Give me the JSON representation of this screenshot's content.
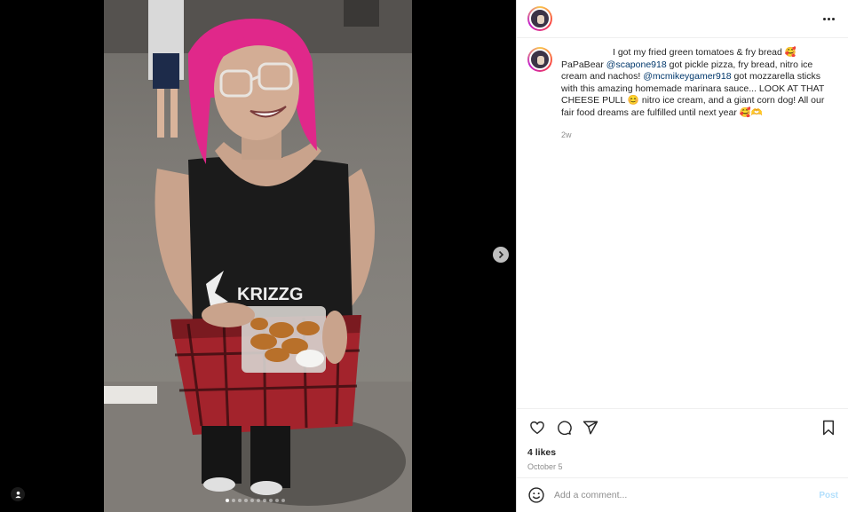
{
  "post": {
    "caption_line1": "I got my fried green tomatoes & fry bread 🥰",
    "caption_parts": [
      {
        "t": "PaPaBear ",
        "mention": false
      },
      {
        "t": "@scapone918",
        "mention": true
      },
      {
        "t": " got pickle pizza, fry bread, nitro ice cream and nachos! ",
        "mention": false
      },
      {
        "t": "@mcmikeygamer918",
        "mention": true
      },
      {
        "t": " got mozzarella sticks with this amazing homemade marinara sauce... LOOK AT THAT CHEESE PULL 😊 nitro ice cream, and a giant corn dog! All our fair food dreams are fulfilled until next year 🥰🫶",
        "mention": false
      }
    ],
    "relative_time": "2w",
    "likes": "4 likes",
    "date": "October 5"
  },
  "comment_box": {
    "placeholder": "Add a comment...",
    "post_label": "Post"
  },
  "carousel": {
    "total": 10,
    "active_index": 0
  },
  "icons": {
    "more": "more-horizontal-icon",
    "like": "heart-icon",
    "comment": "comment-icon",
    "share": "send-icon",
    "save": "bookmark-icon",
    "emoji": "emoji-icon",
    "next": "chevron-right-icon",
    "tag": "user-tag-icon"
  },
  "colors": {
    "mention": "#00376b",
    "post_disabled": "#b2dffc",
    "secondary_text": "#8e8e8e"
  }
}
